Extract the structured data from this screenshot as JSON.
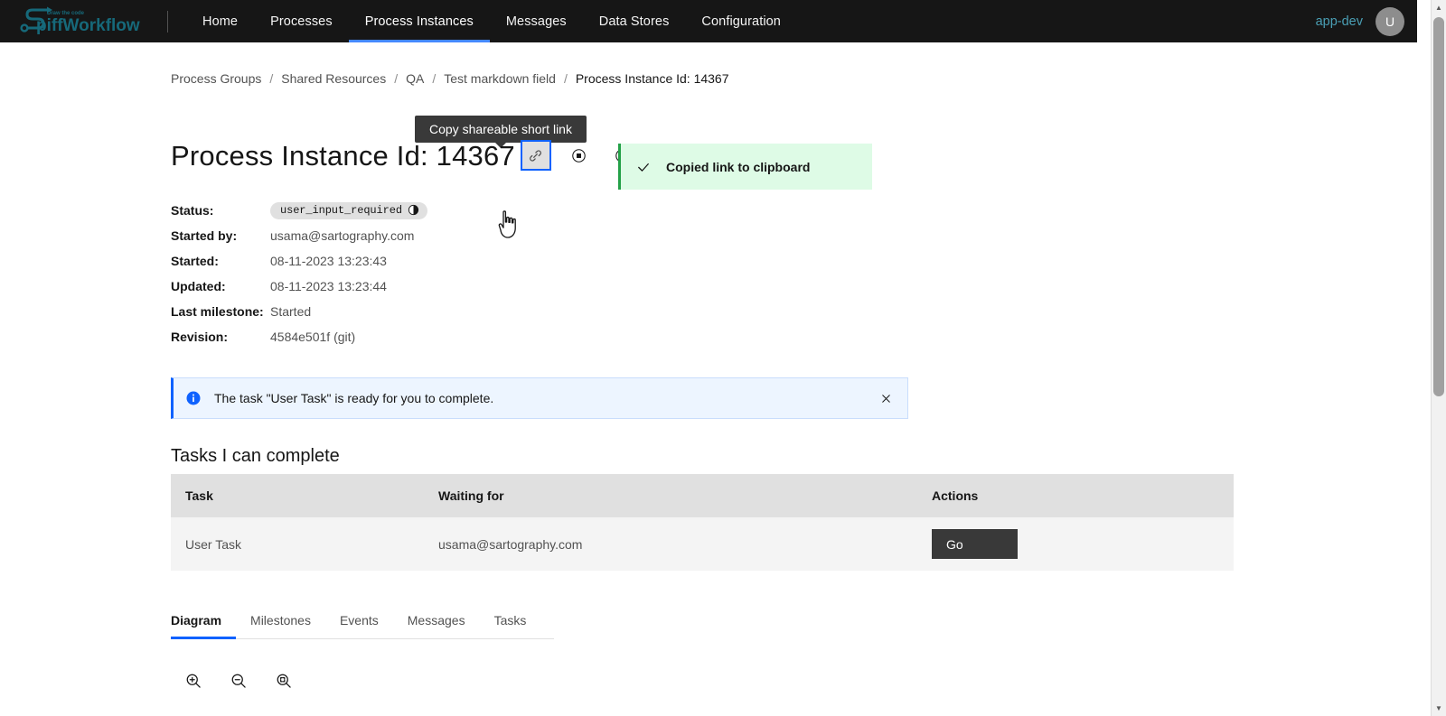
{
  "brand": {
    "name": "SpiffWorkflow",
    "tagline": "Draw the code"
  },
  "topnav": {
    "items": [
      {
        "label": "Home",
        "active": false
      },
      {
        "label": "Processes",
        "active": false
      },
      {
        "label": "Process Instances",
        "active": true
      },
      {
        "label": "Messages",
        "active": false
      },
      {
        "label": "Data Stores",
        "active": false
      },
      {
        "label": "Configuration",
        "active": false
      }
    ],
    "env_label": "app-dev",
    "avatar_initial": "U"
  },
  "breadcrumb": {
    "items": [
      "Process Groups",
      "Shared Resources",
      "QA",
      "Test markdown field"
    ],
    "separator": "/",
    "current": "Process Instance Id: 14367"
  },
  "tooltip": {
    "text": "Copy shareable short link"
  },
  "header": {
    "title": "Process Instance Id: 14367",
    "buttons": [
      {
        "name": "copy-short-link-button",
        "icon": "link-icon",
        "focused": true
      },
      {
        "name": "terminate-button",
        "icon": "stop-icon",
        "focused": false
      },
      {
        "name": "suspend-button",
        "icon": "pause-icon",
        "focused": false
      }
    ]
  },
  "toast": {
    "icon": "checkmark-icon",
    "message": "Copied link to clipboard",
    "accent_color": "#24a148",
    "background_color": "#defbe6"
  },
  "meta": {
    "rows": [
      {
        "label": "Status:",
        "value": "user_input_required",
        "is_tag": true
      },
      {
        "label": "Started by:",
        "value": "usama@sartography.com",
        "is_tag": false
      },
      {
        "label": "Started:",
        "value": "08-11-2023 13:23:43",
        "is_tag": false
      },
      {
        "label": "Updated:",
        "value": "08-11-2023 13:23:44",
        "is_tag": false
      },
      {
        "label": "Last milestone:",
        "value": "Started",
        "is_tag": false
      },
      {
        "label": "Revision:",
        "value": "4584e501f (git)",
        "is_tag": false
      }
    ]
  },
  "info_banner": {
    "icon": "information-filled-icon",
    "message": "The task \"User Task\" is ready for you to complete.",
    "close_label": "×",
    "accent_color": "#0f62fe",
    "background_color": "#edf5ff"
  },
  "tasks_section": {
    "heading": "Tasks I can complete",
    "columns": [
      "Task",
      "Waiting for",
      "Actions"
    ],
    "rows": [
      {
        "task": "User Task",
        "waiting_for": "usama@sartography.com",
        "action_label": "Go"
      }
    ]
  },
  "tabs": {
    "items": [
      {
        "label": "Diagram",
        "active": true
      },
      {
        "label": "Milestones",
        "active": false
      },
      {
        "label": "Events",
        "active": false
      },
      {
        "label": "Messages",
        "active": false
      },
      {
        "label": "Tasks",
        "active": false
      }
    ],
    "accent_color": "#0f62fe"
  },
  "zoom_controls": {
    "buttons": [
      {
        "name": "zoom-in-icon",
        "label": "+"
      },
      {
        "name": "zoom-out-icon",
        "label": "−"
      },
      {
        "name": "zoom-fit-icon",
        "label": "fit"
      }
    ]
  }
}
